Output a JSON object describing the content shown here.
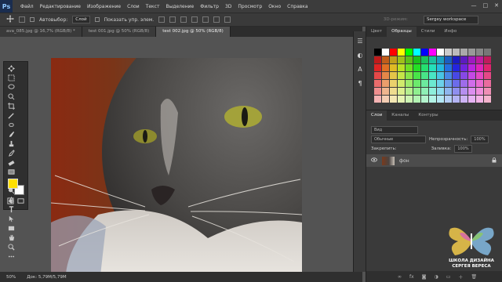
{
  "app": {
    "logo": "Ps"
  },
  "menu": [
    "Файл",
    "Редактирование",
    "Изображение",
    "Слои",
    "Текст",
    "Выделение",
    "Фильтр",
    "3D",
    "Просмотр",
    "Окно",
    "Справка"
  ],
  "window_controls": [
    "—",
    "□",
    "✕"
  ],
  "options_bar": {
    "autoselect_label": "Автовыбор:",
    "autoselect_value": "Слой",
    "show_controls_label": "Показать упр. элем.",
    "threeD_label": "3D-режим:",
    "workspace": "Sergey workspace"
  },
  "doc_tabs": [
    {
      "label": "ava_085.jpg @ 16,7% (RGB/8) *",
      "active": false
    },
    {
      "label": "test 001.jpg @ 50% (RGB/8)",
      "active": false
    },
    {
      "label": "test 002.jpg @ 50% (RGB/8)",
      "active": true
    }
  ],
  "status": {
    "zoom": "50%",
    "doc_size": "Док: 5,79M/5,79M"
  },
  "swatches_panel": {
    "tabs": [
      "Цвет",
      "Образцы",
      "Стили",
      "Инфо"
    ],
    "active_tab": "Образцы"
  },
  "layers_panel": {
    "tabs": [
      "Слои",
      "Каналы",
      "Контуры"
    ],
    "active_tab": "Слои",
    "filter_placeholder": "Вид",
    "blend_mode": "Обычные",
    "opacity_label": "Непрозрачность:",
    "opacity_value": "100%",
    "lock_label": "Закрепить:",
    "fill_label": "Заливка:",
    "fill_value": "100%",
    "layer_name": "фон"
  },
  "watermark": {
    "line1": "ШКОЛА ДИЗАЙНА",
    "line2": "СЕРГЕЯ ВЕРЕСА"
  },
  "colors": {
    "foreground": "#ffe000",
    "background": "#ffffff",
    "ui_dark": "#2f2f2f"
  }
}
